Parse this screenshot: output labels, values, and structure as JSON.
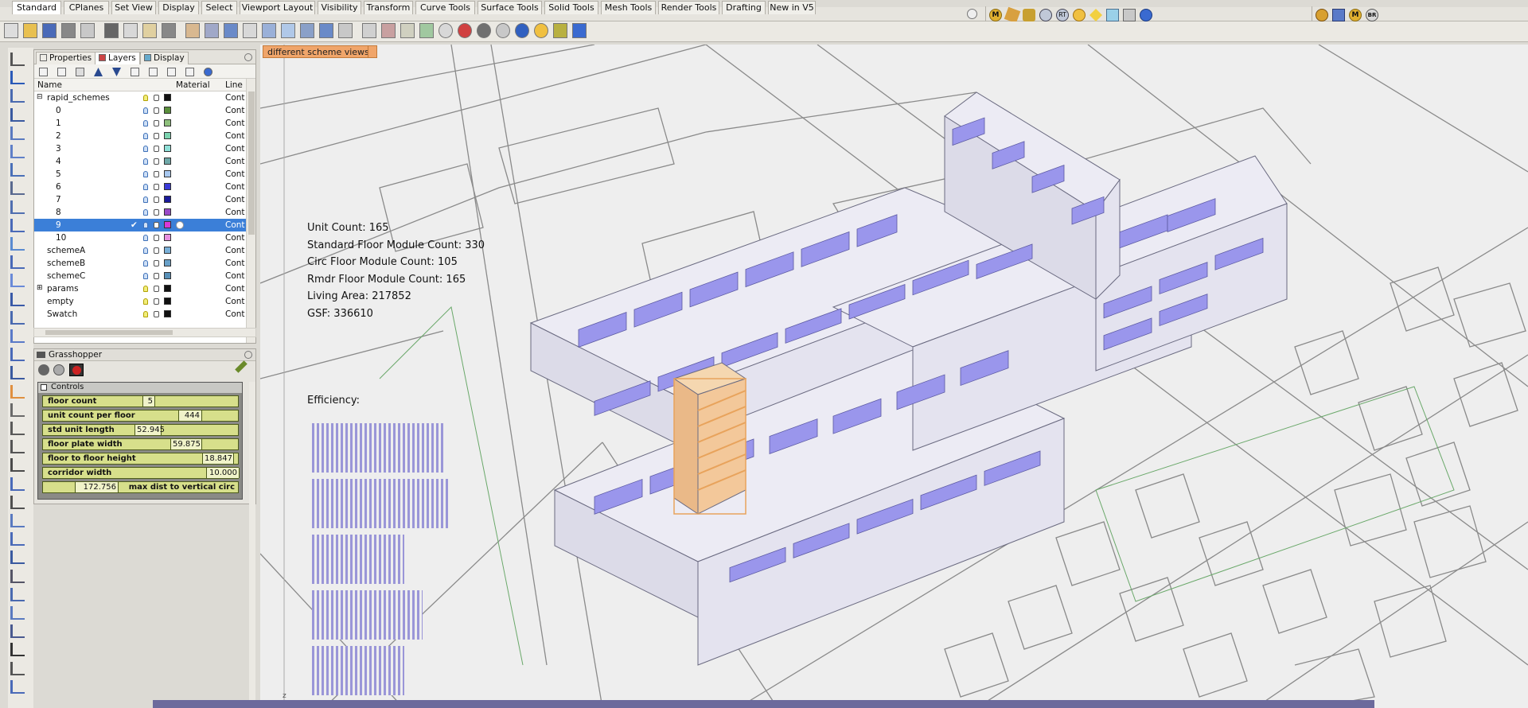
{
  "toolbar_tabs": [
    "Standard",
    "CPlanes",
    "Set View",
    "Display",
    "Select",
    "Viewport Layout",
    "Visibility",
    "Transform",
    "Curve Tools",
    "Surface Tools",
    "Solid Tools",
    "Mesh Tools",
    "Render Tools",
    "Drafting",
    "New in V5"
  ],
  "right_toolbar_labels": [
    "M",
    "RT",
    "M",
    "BR"
  ],
  "panel_tabs": {
    "properties": "Properties",
    "layers": "Layers",
    "display": "Display"
  },
  "layer_columns": {
    "name": "Name",
    "material": "Material",
    "line": "Line"
  },
  "layers": [
    {
      "name": "rapid_schemes",
      "linetype": "Cont",
      "color": "#111111",
      "expand": "⊟"
    },
    {
      "name": "0",
      "linetype": "Cont",
      "color": "#5a8f3c"
    },
    {
      "name": "1",
      "linetype": "Cont",
      "color": "#8ec07c"
    },
    {
      "name": "2",
      "linetype": "Cont",
      "color": "#7cd4b0"
    },
    {
      "name": "3",
      "linetype": "Cont",
      "color": "#8fe0d8"
    },
    {
      "name": "4",
      "linetype": "Cont",
      "color": "#6fa8a8"
    },
    {
      "name": "5",
      "linetype": "Cont",
      "color": "#a8c8f0"
    },
    {
      "name": "6",
      "linetype": "Cont",
      "color": "#3a3ad8"
    },
    {
      "name": "7",
      "linetype": "Cont",
      "color": "#1a1a9a"
    },
    {
      "name": "8",
      "linetype": "Cont",
      "color": "#9a4ac8"
    },
    {
      "name": "9",
      "linetype": "Cont",
      "color": "#d838d8",
      "check": "✔"
    },
    {
      "name": "10",
      "linetype": "Cont",
      "color": "#e890e0"
    },
    {
      "name": "schemeA",
      "linetype": "Cont",
      "color": "#7ab0d8"
    },
    {
      "name": "schemeB",
      "linetype": "Cont",
      "color": "#68a0c8"
    },
    {
      "name": "schemeC",
      "linetype": "Cont",
      "color": "#5890b8"
    },
    {
      "name": "params",
      "linetype": "Cont",
      "color": "#111111",
      "expand": "⊞"
    },
    {
      "name": "empty",
      "linetype": "Cont",
      "color": "#111111"
    },
    {
      "name": "Swatch",
      "linetype": "Cont",
      "color": "#111111"
    }
  ],
  "grasshopper": {
    "title": "Grasshopper",
    "group": "Controls",
    "sliders": [
      {
        "name": "floor count",
        "value": "5"
      },
      {
        "name": "unit count per floor",
        "value": "444"
      },
      {
        "name": "std unit length",
        "value": "52.945"
      },
      {
        "name": "floor plate width",
        "value": "59.875"
      },
      {
        "name": "floor to floor height",
        "value": "18.847"
      },
      {
        "name": "corridor width",
        "value": "10.000"
      },
      {
        "name": "max dist to vertical circ",
        "value": "172.756"
      }
    ]
  },
  "viewport": {
    "label": "different scheme views",
    "axis_label": "z",
    "stats": [
      "Unit Count: 165",
      "Standard Floor Module Count: 330",
      "Circ Floor Module Count: 105",
      "Rmdr Floor Module Count: 165",
      "Living Area: 217852",
      "GSF: 336610"
    ],
    "efficiency_label": "Efficiency:",
    "efficiency_bars": [
      0.87,
      0.9,
      0.61,
      0.73,
      0.61
    ]
  },
  "colors": {
    "accent": "#f0a56a",
    "building_glass": "#9a96ec",
    "highlight_module": "#e8a35c",
    "slider_fill": "#d7df8b",
    "bottom_bar": "#6c6a9c"
  }
}
